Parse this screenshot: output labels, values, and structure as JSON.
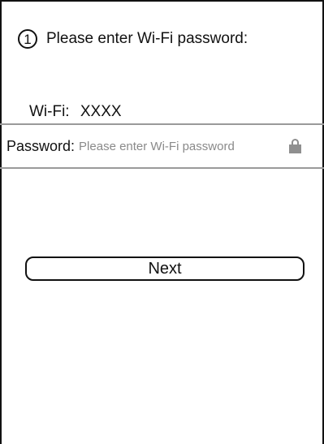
{
  "step": {
    "number": "1",
    "title": "Please enter Wi-Fi password:"
  },
  "wifi": {
    "label": "Wi-Fi:",
    "name": "XXXX"
  },
  "password": {
    "label": "Password:",
    "placeholder": "Please enter Wi-Fi password",
    "value": "",
    "icon": "lock-icon"
  },
  "actions": {
    "next_label": "Next"
  },
  "colors": {
    "text": "#111111",
    "placeholder": "#8a8a8a",
    "divider": "#9a9a9a",
    "icon": "#8f8f8f",
    "background": "#ffffff"
  }
}
